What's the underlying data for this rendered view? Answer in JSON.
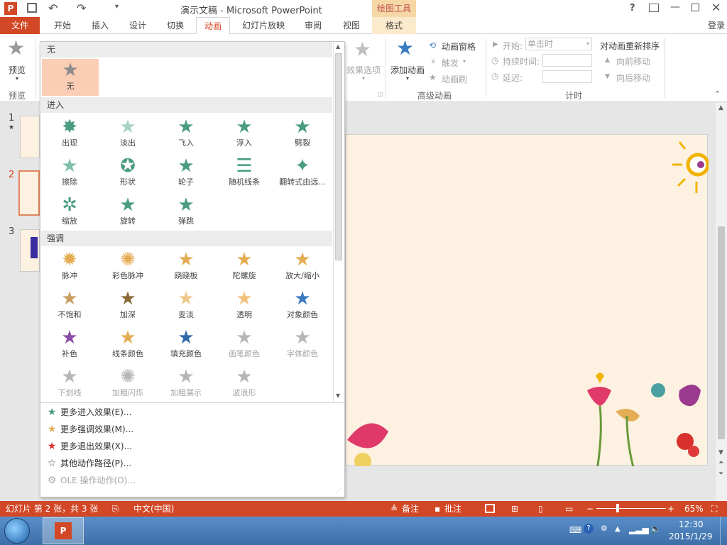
{
  "window": {
    "title": "演示文稿 - Microsoft PowerPoint",
    "context_tab": "绘图工具",
    "help": "?",
    "login": "登录"
  },
  "tabs": [
    "文件",
    "开始",
    "插入",
    "设计",
    "切换",
    "动画",
    "幻灯片放映",
    "审阅",
    "视图",
    "格式"
  ],
  "ribbon": {
    "preview_label": "预览",
    "preview_group": "预览",
    "effect_options": "效果选项",
    "add_animation": "添加动画",
    "animation_pane": "动画窗格",
    "trigger": "触发",
    "animation_painter": "动画刷",
    "advanced_group": "高级动画",
    "start_label": "开始:",
    "start_value": "单击时",
    "duration_label": "持续时间:",
    "delay_label": "延迟:",
    "timing_group": "计时",
    "reorder_title": "对动画重新排序",
    "move_earlier": "向前移动",
    "move_later": "向后移动"
  },
  "thumbnails": [
    "1",
    "2",
    "3"
  ],
  "dropdown": {
    "sections": {
      "none": "无",
      "entrance": "进入",
      "emphasis": "强调"
    },
    "none_item": "无",
    "entrance": [
      "出现",
      "淡出",
      "飞入",
      "浮入",
      "劈裂",
      "擦除",
      "形状",
      "轮子",
      "随机线条",
      "翻转式由远...",
      "缩放",
      "旋转",
      "弹跳"
    ],
    "emphasis": [
      "脉冲",
      "彩色脉冲",
      "跷跷板",
      "陀螺旋",
      "放大/缩小",
      "不饱和",
      "加深",
      "变淡",
      "透明",
      "对象颜色",
      "补色",
      "线条颜色",
      "填充颜色",
      "画笔颜色",
      "字体颜色",
      "下划线",
      "加粗闪烁",
      "加粗展示",
      "波浪形"
    ],
    "more": [
      {
        "label": "更多进入效果(E)...",
        "icon": "green-star-icon"
      },
      {
        "label": "更多强调效果(M)...",
        "icon": "gold-star-icon"
      },
      {
        "label": "更多退出效果(X)...",
        "icon": "red-star-icon"
      },
      {
        "label": "其他动作路径(P)...",
        "icon": "outline-star-icon"
      },
      {
        "label": "OLE 操作动作(O)...",
        "icon": "gear-icon"
      }
    ]
  },
  "status": {
    "slide_info": "幻灯片 第 2 张，共 3 张",
    "language": "中文(中国)",
    "notes": "备注",
    "comments": "批注",
    "zoom": "65%"
  },
  "taskbar": {
    "time": "12:30",
    "date": "2015/1/29"
  },
  "colors": {
    "accent": "#d24726",
    "context_tab_bg": "#f6d7a6",
    "entrance_star": "#4a9c7f",
    "emphasis_star": "#e4ad54",
    "selected_bg": "#fbcdb5",
    "slide_bg": "#fdf1e1"
  }
}
